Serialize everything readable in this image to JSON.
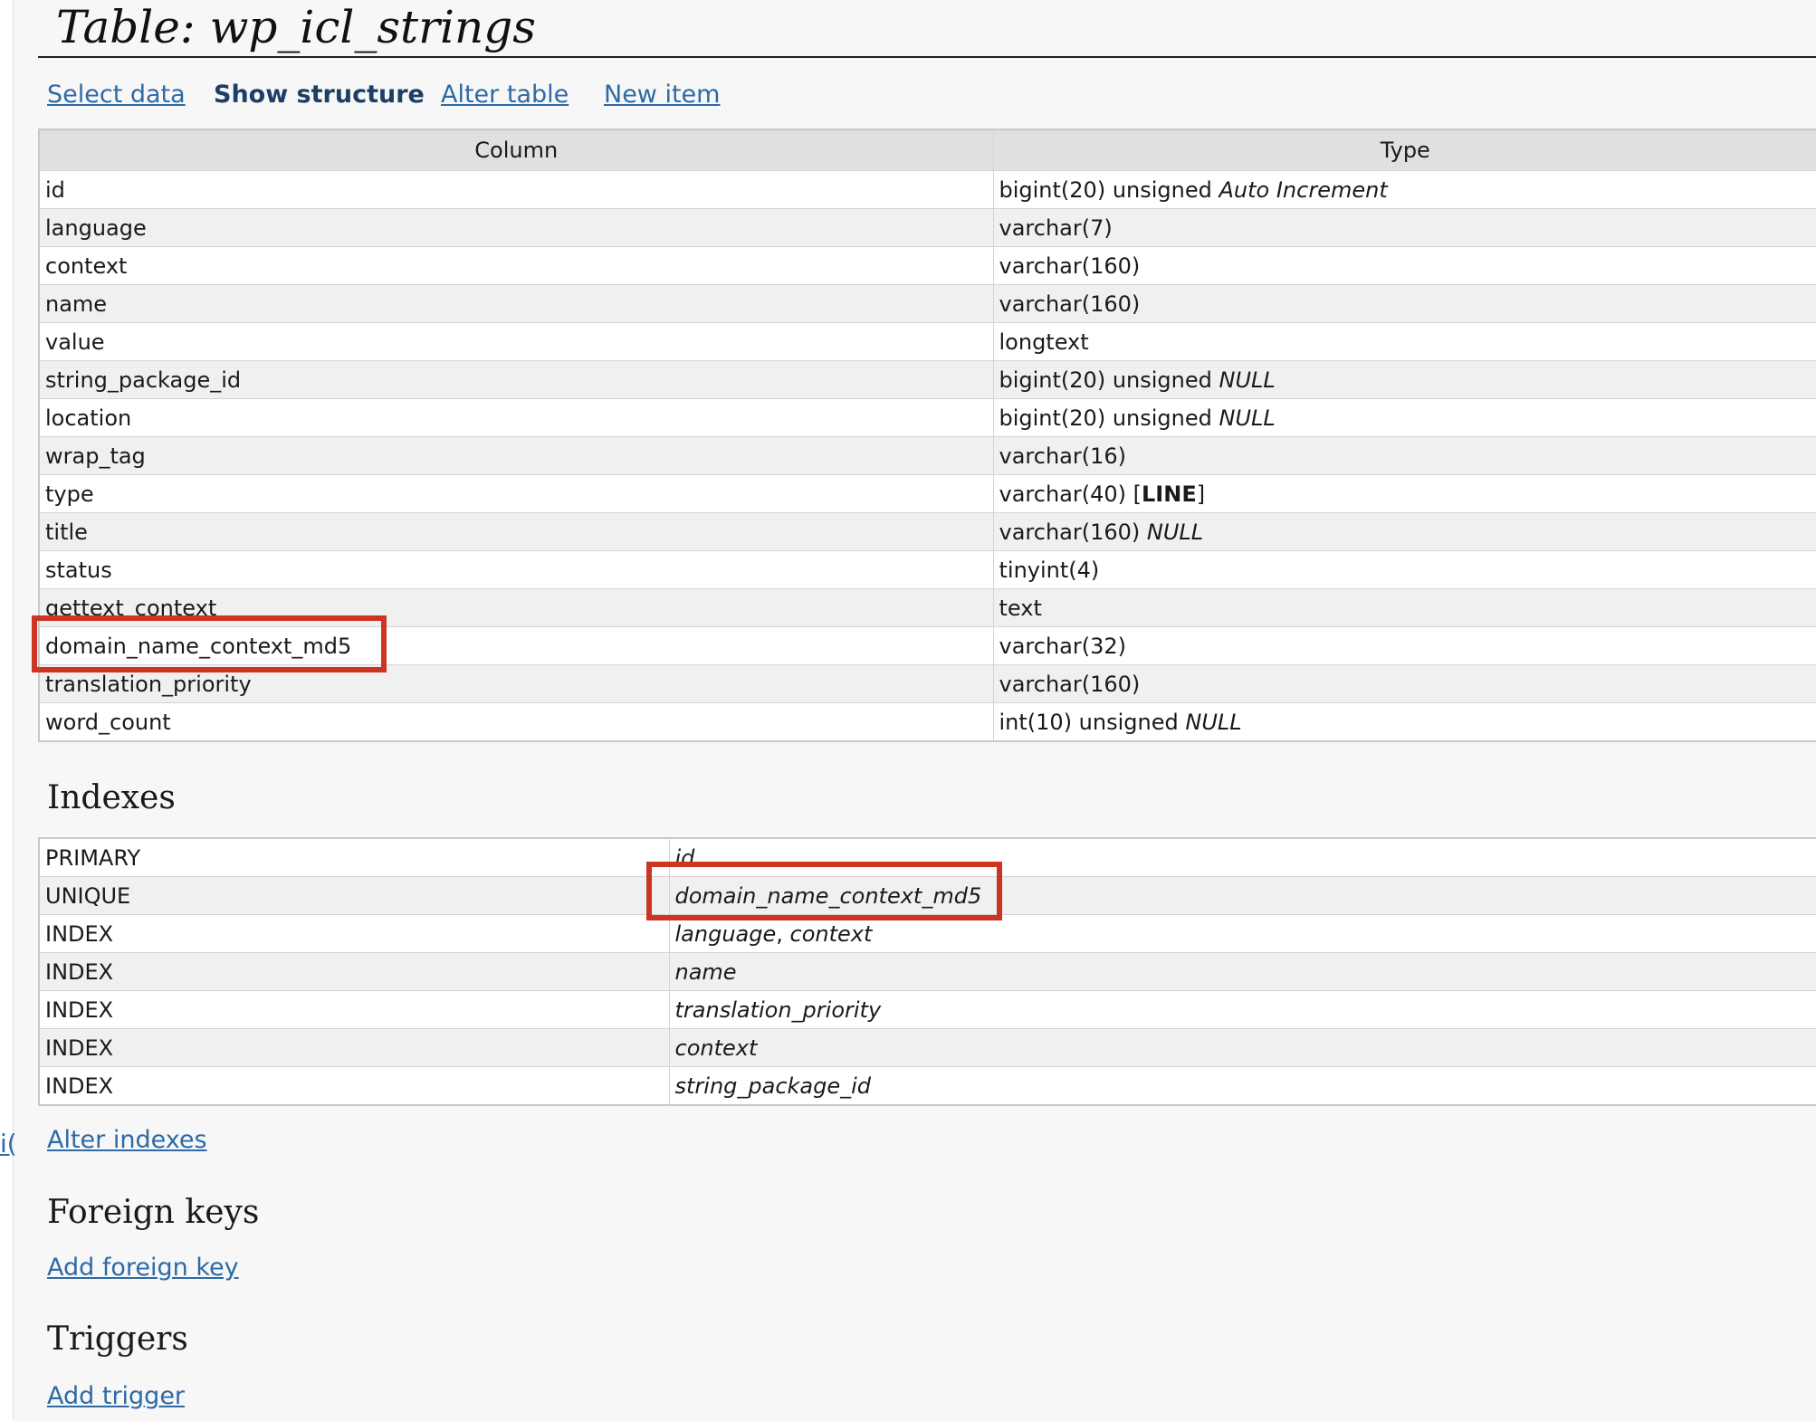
{
  "page": {
    "title": "Table: wp_icl_strings",
    "cut_off_link_fragment": "i("
  },
  "nav": {
    "select_data": "Select data",
    "show_structure": "Show structure",
    "alter_table": "Alter table",
    "new_item": "New item"
  },
  "structure": {
    "headers": {
      "column": "Column",
      "type": "Type"
    },
    "rows": [
      {
        "name": "id",
        "type": "bigint(20) unsigned",
        "type_extra": "Auto Increment",
        "type_extra_style": "italic"
      },
      {
        "name": "language",
        "type": "varchar(7)",
        "type_extra": "",
        "type_extra_style": ""
      },
      {
        "name": "context",
        "type": "varchar(160)",
        "type_extra": "",
        "type_extra_style": ""
      },
      {
        "name": "name",
        "type": "varchar(160)",
        "type_extra": "",
        "type_extra_style": ""
      },
      {
        "name": "value",
        "type": "longtext",
        "type_extra": "",
        "type_extra_style": ""
      },
      {
        "name": "string_package_id",
        "type": "bigint(20) unsigned",
        "type_extra": "NULL",
        "type_extra_style": "italic"
      },
      {
        "name": "location",
        "type": "bigint(20) unsigned",
        "type_extra": "NULL",
        "type_extra_style": "italic"
      },
      {
        "name": "wrap_tag",
        "type": "varchar(16)",
        "type_extra": "",
        "type_extra_style": ""
      },
      {
        "name": "type",
        "type": "varchar(40)",
        "type_extra": "[LINE]",
        "type_extra_style": "bold-default"
      },
      {
        "name": "title",
        "type": "varchar(160)",
        "type_extra": "NULL",
        "type_extra_style": "italic"
      },
      {
        "name": "status",
        "type": "tinyint(4)",
        "type_extra": "",
        "type_extra_style": ""
      },
      {
        "name": "gettext_context",
        "type": "text",
        "type_extra": "",
        "type_extra_style": ""
      },
      {
        "name": "domain_name_context_md5",
        "type": "varchar(32)",
        "type_extra": "",
        "type_extra_style": ""
      },
      {
        "name": "translation_priority",
        "type": "varchar(160)",
        "type_extra": "",
        "type_extra_style": ""
      },
      {
        "name": "word_count",
        "type": "int(10) unsigned",
        "type_extra": "NULL",
        "type_extra_style": "italic"
      }
    ]
  },
  "indexes": {
    "heading": "Indexes",
    "rows": [
      {
        "kind": "PRIMARY",
        "columns": [
          "id"
        ]
      },
      {
        "kind": "UNIQUE",
        "columns": [
          "domain_name_context_md5"
        ]
      },
      {
        "kind": "INDEX",
        "columns": [
          "language",
          "context"
        ]
      },
      {
        "kind": "INDEX",
        "columns": [
          "name"
        ]
      },
      {
        "kind": "INDEX",
        "columns": [
          "translation_priority"
        ]
      },
      {
        "kind": "INDEX",
        "columns": [
          "context"
        ]
      },
      {
        "kind": "INDEX",
        "columns": [
          "string_package_id"
        ]
      }
    ],
    "alter_link": "Alter indexes"
  },
  "foreign_keys": {
    "heading": "Foreign keys",
    "add_link": "Add foreign key"
  },
  "triggers": {
    "heading": "Triggers",
    "add_link": "Add trigger"
  },
  "annotations": {
    "highlight_color": "#cc3522",
    "highlighted_items": [
      "structure column: domain_name_context_md5",
      "unique index column: domain_name_context_md5"
    ]
  },
  "colors": {
    "link": "#2d6aa6",
    "active_link": "#1c3f66",
    "header_bg": "#e0e0e0",
    "alt_row_bg": "#f0f0f0",
    "page_bg": "#f7f7f7"
  }
}
